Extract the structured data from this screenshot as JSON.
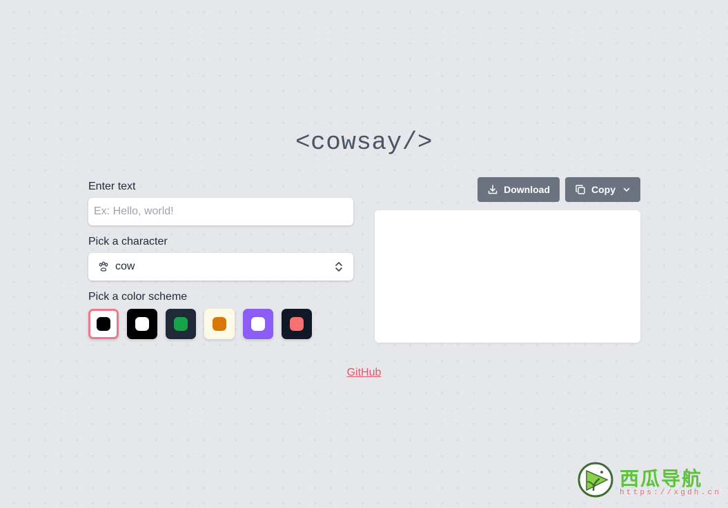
{
  "title": "<cowsay/>",
  "form": {
    "text_label": "Enter text",
    "text_placeholder": "Ex: Hello, world!",
    "text_value": "",
    "character_label": "Pick a character",
    "character_value": "cow",
    "color_label": "Pick a color scheme",
    "color_schemes": [
      {
        "bg": "#ffffff",
        "dot": "#000000",
        "selected": true
      },
      {
        "bg": "#000000",
        "dot": "#ffffff",
        "selected": false
      },
      {
        "bg": "#1f2937",
        "dot": "#16a34a",
        "selected": false
      },
      {
        "bg": "#fef9e7",
        "dot": "#d97706",
        "selected": false
      },
      {
        "bg": "#8b5cf6",
        "dot": "#ffffff",
        "selected": false
      },
      {
        "bg": "#111827",
        "dot": "#f87171",
        "selected": false
      }
    ]
  },
  "toolbar": {
    "download_label": "Download",
    "copy_label": "Copy"
  },
  "footer": {
    "github_label": "GitHub"
  },
  "watermark": {
    "name": "西瓜导航",
    "url": "https://xgdh.cn"
  },
  "colors": {
    "background": "#e5e7eb",
    "button": "#6b7280",
    "accent": "#e0566e",
    "selected_border": "#f0768a"
  }
}
